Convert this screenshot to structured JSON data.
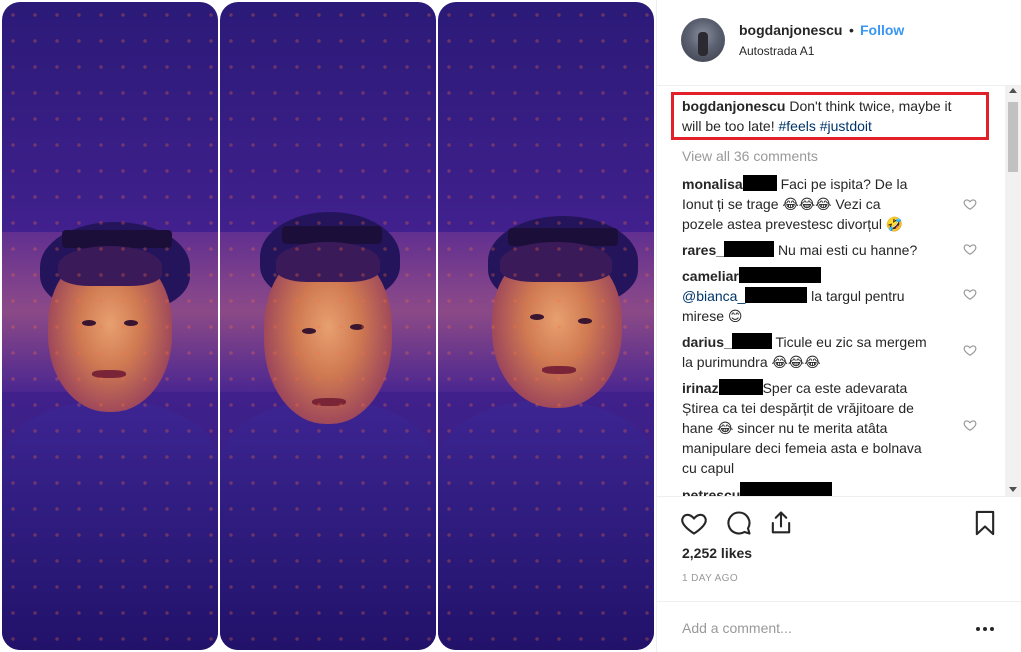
{
  "header": {
    "username": "bogdanjonescu",
    "separator": "•",
    "follow_label": "Follow",
    "location": "Autostrada A1"
  },
  "caption": {
    "username": "bogdanjonescu",
    "text": "Don't think twice, maybe it will be too late!",
    "hashtags": [
      "#feels",
      "#justdoit"
    ]
  },
  "view_all": "View all 36 comments",
  "comments": [
    {
      "username": "monalisa",
      "line1": "Faci pe ispita? De la",
      "line2": "Ionut ți se trage 😂😂😂 Vezi ca",
      "line3": "pozele astea prevestesc divorțul 🤣"
    },
    {
      "username": "rares_",
      "line1": "Nu mai esti cu hanne?"
    },
    {
      "username": "cameliar",
      "mention": "@bianca_",
      "line1": "la targul pentru",
      "line2": "mirese 😊"
    },
    {
      "username": "darius_",
      "line1": "Ticule eu zic sa mergem",
      "line2": "la purimundra 😂😂😂"
    },
    {
      "username": "irinaz",
      "line1": "Sper ca este adevarata",
      "line2": "Știrea ca tei despărțit de vrăjitoare de",
      "line3": "hane 😂 sincer nu te merita atâta",
      "line4": "manipulare deci femeia asta e bolnava",
      "line5": "cu capul"
    },
    {
      "username": "petrescu"
    }
  ],
  "likes": "2,252 likes",
  "time": "1 DAY AGO",
  "add_comment_placeholder": "Add a comment...",
  "icons": {
    "like": "heart-icon",
    "comment": "comment-icon",
    "share": "share-icon",
    "save": "bookmark-icon",
    "more": "more-icon"
  },
  "colors": {
    "follow": "#3897f0",
    "highlight_box": "#e2202a",
    "hashtag": "#003569",
    "muted": "#999999"
  }
}
